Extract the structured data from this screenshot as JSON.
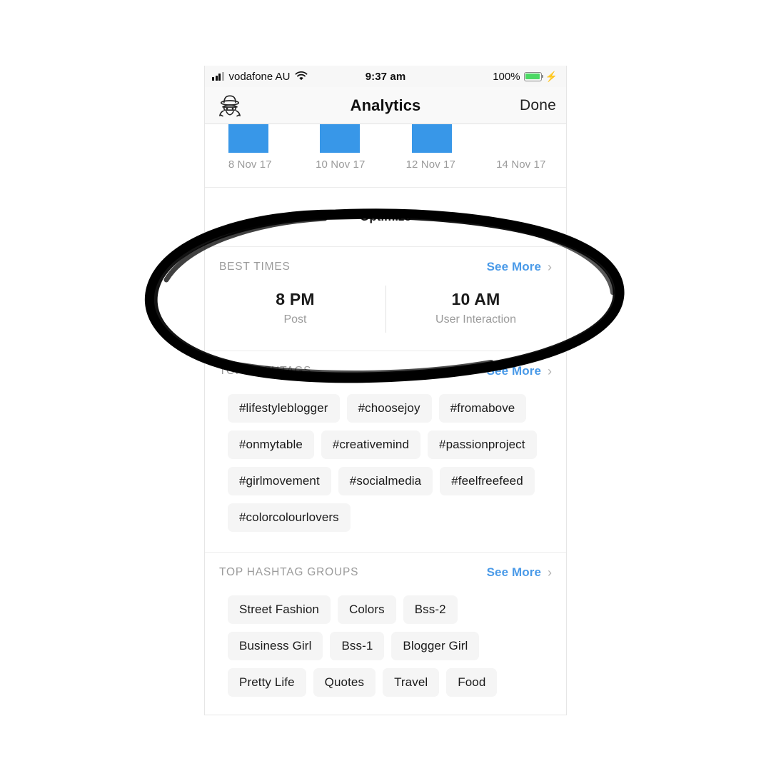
{
  "status_bar": {
    "carrier": "vodafone AU",
    "signal_icon": "signal-bars-icon",
    "wifi_icon": "wifi-icon",
    "time": "9:37 am",
    "battery_percent": "100%",
    "battery_icon": "battery-icon",
    "charging_icon": "lightning-bolt-icon",
    "battery_color": "#4cd964"
  },
  "nav_bar": {
    "left_icon": "incognito-spy-icon",
    "title": "Analytics",
    "done_label": "Done"
  },
  "chart": {
    "bar_color": "#3897e8",
    "labels": [
      "8 Nov 17",
      "10 Nov 17",
      "12 Nov 17",
      "14 Nov 17"
    ]
  },
  "optimize_section": {
    "text": "Optimize",
    "note": "partially obscured by hand-drawn annotation"
  },
  "best_times": {
    "title": "BEST TIMES",
    "see_more": "See More",
    "chevron": "chevron-right-icon",
    "columns": [
      {
        "value": "8 PM",
        "label": "Post"
      },
      {
        "value": "10 AM",
        "label": "User Interaction"
      }
    ]
  },
  "top_hashtags": {
    "title": "TOP HASHTAGS",
    "see_more": "See More",
    "chevron": "chevron-right-icon",
    "items": [
      "#lifestyleblogger",
      "#choosejoy",
      "#fromabove",
      "#onmytable",
      "#creativemind",
      "#passionproject",
      "#girlmovement",
      "#socialmedia",
      "#feelfreefeed",
      "#colorcolourlovers"
    ]
  },
  "top_hashtag_groups": {
    "title": "TOP HASHTAG GROUPS",
    "see_more": "See More",
    "chevron": "chevron-right-icon",
    "items": [
      "Street Fashion",
      "Colors",
      "Bss-2",
      "Business Girl",
      "Bss-1",
      "Blogger Girl",
      "Pretty Life",
      "Quotes",
      "Travel",
      "Food"
    ]
  },
  "annotation": {
    "type": "hand-drawn-ellipse",
    "color": "#000000",
    "highlights": "BEST TIMES section"
  },
  "colors": {
    "accent_blue": "#4a9ae8",
    "bar_blue": "#3897e8",
    "chip_bg": "#f5f5f5",
    "muted_text": "#9b9b9b"
  }
}
